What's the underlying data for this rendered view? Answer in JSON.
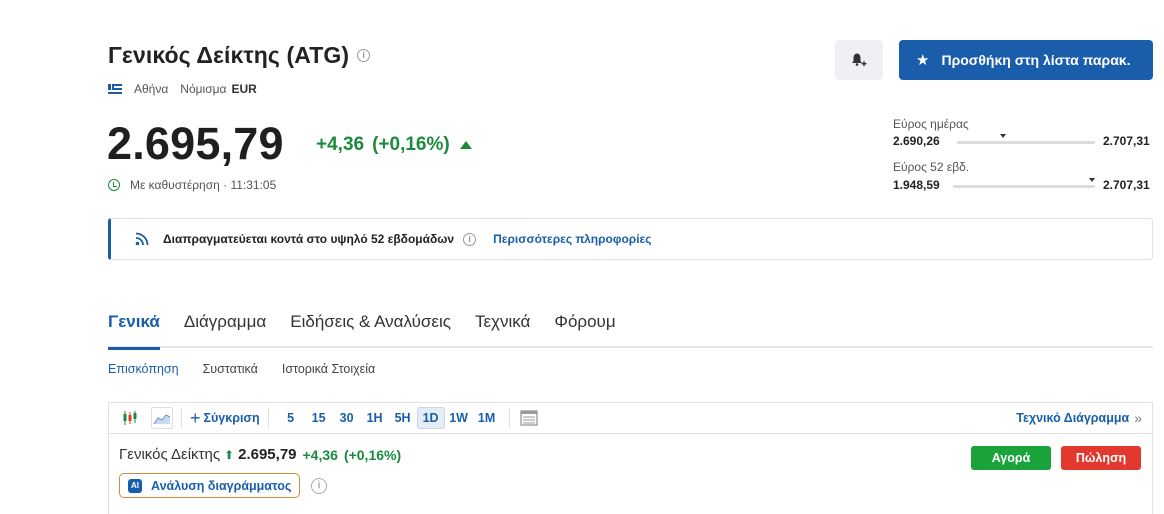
{
  "instrument": {
    "title": "Γενικός Δείκτης (ATG)",
    "exchange": "Αθήνα",
    "currency_label": "Νόμισμα",
    "currency": "EUR",
    "price": "2.695,79",
    "change": "+4,36",
    "change_pct": "(+0,16%)",
    "delay_text": "Με καθυστέρηση · 11:31:05"
  },
  "actions": {
    "watchlist_label": "Προσθήκη στη λίστα παρακ.",
    "bell_icon": "bell-plus-icon"
  },
  "ranges": {
    "day": {
      "label": "Εύρος ημέρας",
      "low": "2.690,26",
      "high": "2.707,31",
      "position": 0.33
    },
    "week52": {
      "label": "Εύρος 52 εβδ.",
      "low": "1.948,59",
      "high": "2.707,31",
      "position": 0.98
    }
  },
  "banner": {
    "message": "Διαπραγματεύεται κοντά στο υψηλό 52 εβδομάδων",
    "link": "Περισσότερες πληροφορίες"
  },
  "tabs": [
    "Γενικά",
    "Διάγραμμα",
    "Ειδήσεις & Αναλύσεις",
    "Τεχνικά",
    "Φόρουμ"
  ],
  "subtabs": [
    "Επισκόπηση",
    "Συστατικά",
    "Ιστορικά Στοιχεία"
  ],
  "toolbar": {
    "compare": "Σύγκριση",
    "periods": [
      "5",
      "15",
      "30",
      "1H",
      "5H",
      "1D",
      "1W",
      "1M"
    ],
    "active_period": "1D",
    "tech_chart": "Τεχνικό Διάγραμμα",
    "tech_chevron": "»"
  },
  "quote": {
    "name": "Γενικός Δείκτης",
    "price": "2.695,79",
    "change": "+4,36",
    "change_pct": "(+0,16%)"
  },
  "ai": {
    "badge": "AI",
    "label": "Ανάλυση διαγράμματος"
  },
  "trade": {
    "buy": "Αγορά",
    "sell": "Πώληση"
  },
  "colors": {
    "accent": "#1a5eab",
    "positive": "#1b8a3e",
    "buy": "#1aa33b",
    "sell": "#e3382d"
  }
}
